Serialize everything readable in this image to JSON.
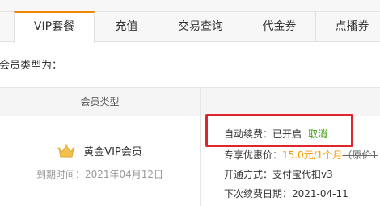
{
  "tabs": [
    {
      "label": "VIP套餐"
    },
    {
      "label": "充值"
    },
    {
      "label": "交易查询"
    },
    {
      "label": "代金券"
    },
    {
      "label": "点播券"
    }
  ],
  "prompt": "会员类型为：",
  "table": {
    "header_member_type": "会员类型"
  },
  "member": {
    "name": "黄金VIP会员",
    "expire": "到期时间：2021年04月12日",
    "icon": "crown-icon"
  },
  "details": {
    "auto_renew_label": "自动续费：",
    "auto_renew_value": "已开启",
    "cancel_label": "取消",
    "price_label": "专享优惠价：",
    "price_value": "15.0元/1个月",
    "original_price": "（原价1",
    "pay_method": "开通方式：支付宝代扣v3",
    "next_renew": "下次续费日期：2021-04-11"
  },
  "colors": {
    "accent": "#f08300",
    "price": "#f39800",
    "cancel": "#3e9c14",
    "highlight_box": "#e0262b"
  }
}
